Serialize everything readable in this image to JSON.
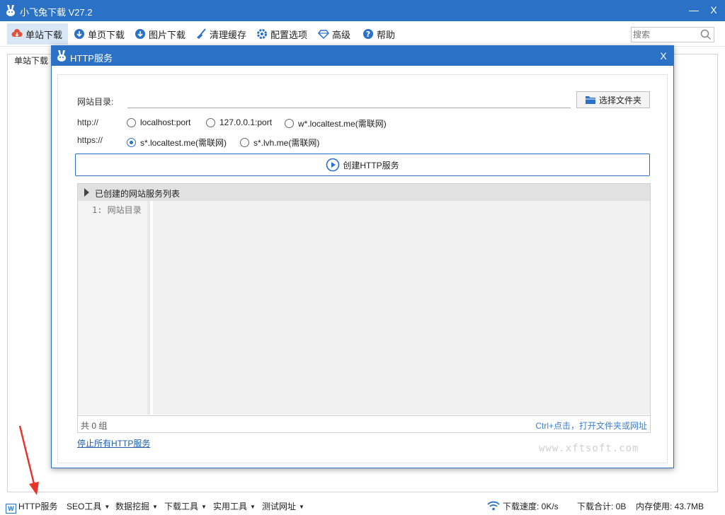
{
  "window": {
    "title": "小飞兔下载 V27.2",
    "minimize": "—",
    "close": "X"
  },
  "toolbar": {
    "items": [
      {
        "label": "单站下载",
        "icon": "cloud-download-icon"
      },
      {
        "label": "单页下载",
        "icon": "download-icon"
      },
      {
        "label": "图片下载",
        "icon": "image-download-icon"
      },
      {
        "label": "清理缓存",
        "icon": "broom-icon"
      },
      {
        "label": "配置选项",
        "icon": "gear-icon"
      },
      {
        "label": "高级",
        "icon": "diamond-icon"
      },
      {
        "label": "帮助",
        "icon": "help-icon"
      }
    ],
    "active_index": 0
  },
  "search": {
    "placeholder": "搜索"
  },
  "main_panel": {
    "label": "单站下载"
  },
  "dialog": {
    "title": "HTTP服务",
    "close": "X",
    "dir_label": "网站目录:",
    "dir_value": "",
    "choose_button": "选择文件夹",
    "http_label": "http://",
    "https_label": "https://",
    "http_options": [
      {
        "label": "localhost:port",
        "checked": false
      },
      {
        "label": "127.0.0.1:port",
        "checked": false
      },
      {
        "label": "w*.localtest.me(需联网)",
        "checked": false
      }
    ],
    "https_options": [
      {
        "label": "s*.localtest.me(需联网)",
        "checked": true
      },
      {
        "label": "s*.lvh.me(需联网)",
        "checked": false
      }
    ],
    "create_button": "创建HTTP服务",
    "list": {
      "header": "已创建的网站服务列表",
      "gutter_line": "1: 网站目录",
      "count": "共 0 组",
      "hint": "Ctrl+点击，打开文件夹或网址"
    },
    "stop_link": "停止所有HTTP服务",
    "watermark": "www.xftsoft.com"
  },
  "statusbar": {
    "http_service": "HTTP服务",
    "menus": [
      "SEO工具",
      "数据挖掘",
      "下载工具",
      "实用工具",
      "测试网址"
    ],
    "speed": "下载速度: 0K/s",
    "total": "下载合计: 0B",
    "memory": "内存使用: 43.7MB"
  },
  "colors": {
    "accent": "#2b72c6",
    "arrow": "#e8352b"
  }
}
